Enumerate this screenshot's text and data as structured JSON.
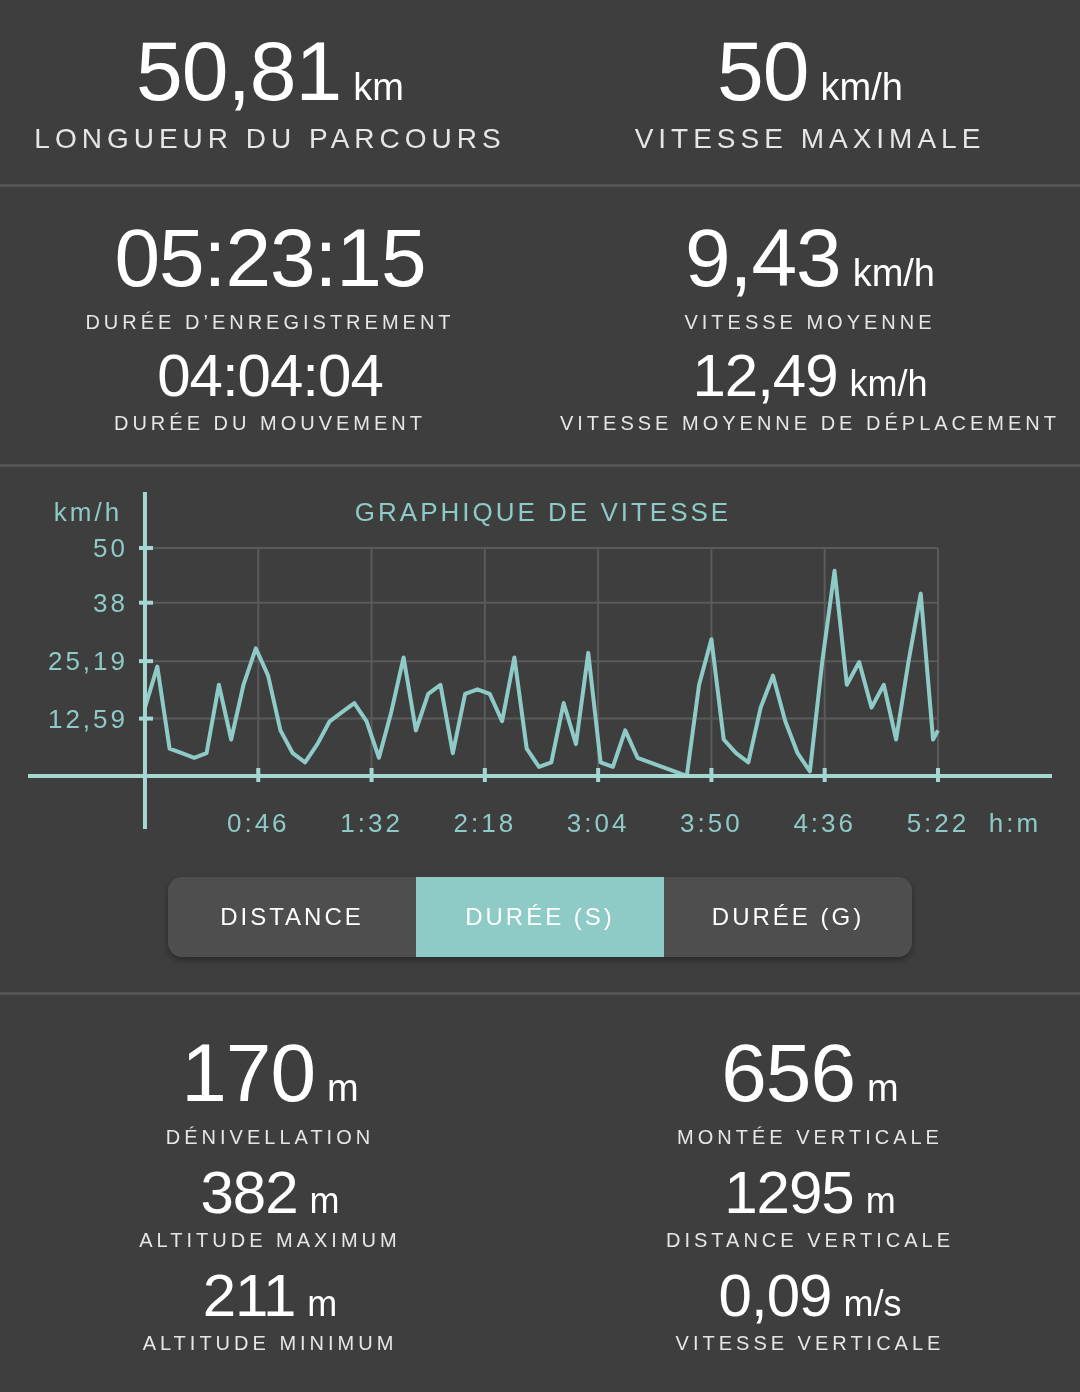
{
  "summary": [
    {
      "kind": "headline",
      "value": "50,81",
      "unit": "km",
      "label": "LONGUEUR DU PARCOURS"
    },
    {
      "kind": "headline",
      "value": "50",
      "unit": "km/h",
      "label": "VITESSE MAXIMALE"
    }
  ],
  "times": {
    "left": [
      {
        "kind": "primary",
        "value": "05:23:15",
        "label": "DURÉE D’ENREGISTREMENT"
      },
      {
        "kind": "secondary",
        "value": "04:04:04",
        "label": "DURÉE DU MOUVEMENT"
      }
    ],
    "right": [
      {
        "kind": "primary",
        "value": "9,43",
        "unit": "km/h",
        "label": "VITESSE MOYENNE"
      },
      {
        "kind": "secondary",
        "value": "12,49",
        "unit": "km/h",
        "label": "VITESSE MOYENNE DE DÉPLACEMENT"
      }
    ]
  },
  "speed_chart": {
    "chart_data": {
      "type": "line",
      "title": "GRAPHIQUE DE VITESSE",
      "xlabel": "h:m",
      "ylabel": "km/h",
      "grid": true,
      "xlim": [
        -47.5,
        368.3
      ],
      "ylim": [
        0,
        50
      ],
      "xticks": [
        {
          "value": 46,
          "label": "0:46"
        },
        {
          "value": 92,
          "label": "1:32"
        },
        {
          "value": 138,
          "label": "2:18"
        },
        {
          "value": 184,
          "label": "3:04"
        },
        {
          "value": 230,
          "label": "3:50"
        },
        {
          "value": 276,
          "label": "4:36"
        },
        {
          "value": 322,
          "label": "5:22"
        }
      ],
      "yticks": [
        {
          "value": 12.59,
          "label": "12,59"
        },
        {
          "value": 25.19,
          "label": "25,19"
        },
        {
          "value": 38,
          "label": "38"
        },
        {
          "value": 50,
          "label": "50"
        }
      ],
      "x": [
        0,
        5,
        10,
        15,
        20,
        25,
        30,
        35,
        40,
        45,
        50,
        55,
        60,
        65,
        70,
        75,
        80,
        85,
        90,
        95,
        100,
        105,
        110,
        115,
        120,
        125,
        130,
        135,
        140,
        145,
        150,
        155,
        160,
        165,
        170,
        175,
        180,
        185,
        190,
        195,
        200,
        205,
        210,
        215,
        220,
        225,
        230,
        235,
        240,
        245,
        250,
        255,
        260,
        265,
        270,
        275,
        280,
        285,
        290,
        295,
        300,
        305,
        310,
        315,
        320,
        322
      ],
      "series": [
        {
          "color": "#8ecac6",
          "values": [
            15,
            24,
            6,
            5,
            4,
            5,
            20,
            8,
            20,
            28,
            22,
            10,
            5,
            3,
            7,
            12,
            14,
            16,
            12,
            4,
            14,
            26,
            10,
            18,
            20,
            5,
            18,
            19,
            18,
            12,
            26,
            6,
            2,
            3,
            16,
            7,
            27,
            3,
            2,
            10,
            4,
            3,
            2,
            1,
            0,
            20,
            30,
            8,
            5,
            3,
            15,
            22,
            12,
            5,
            1,
            25,
            45,
            20,
            25,
            15,
            20,
            8,
            25,
            40,
            8,
            10
          ]
        }
      ]
    }
  },
  "chart_modes": [
    {
      "label": "DISTANCE",
      "selected": false
    },
    {
      "label": "DURÉE (S)",
      "selected": true
    },
    {
      "label": "DURÉE (G)",
      "selected": false
    }
  ],
  "elevation": {
    "left": [
      {
        "kind": "primary",
        "value": "170",
        "unit": "m",
        "label": "DÉNIVELLATION"
      },
      {
        "kind": "secondary",
        "value": "382",
        "unit": "m",
        "label": "ALTITUDE MAXIMUM"
      },
      {
        "kind": "secondary",
        "value": "211",
        "unit": "m",
        "label": "ALTITUDE MINIMUM"
      }
    ],
    "right": [
      {
        "kind": "primary",
        "value": "656",
        "unit": "m",
        "label": "MONTÉE VERTICALE"
      },
      {
        "kind": "secondary",
        "value": "1295",
        "unit": "m",
        "label": "DISTANCE VERTICALE"
      },
      {
        "kind": "secondary",
        "value": "0,09",
        "unit": "m/s",
        "label": "VITESSE VERTICALE"
      }
    ]
  }
}
